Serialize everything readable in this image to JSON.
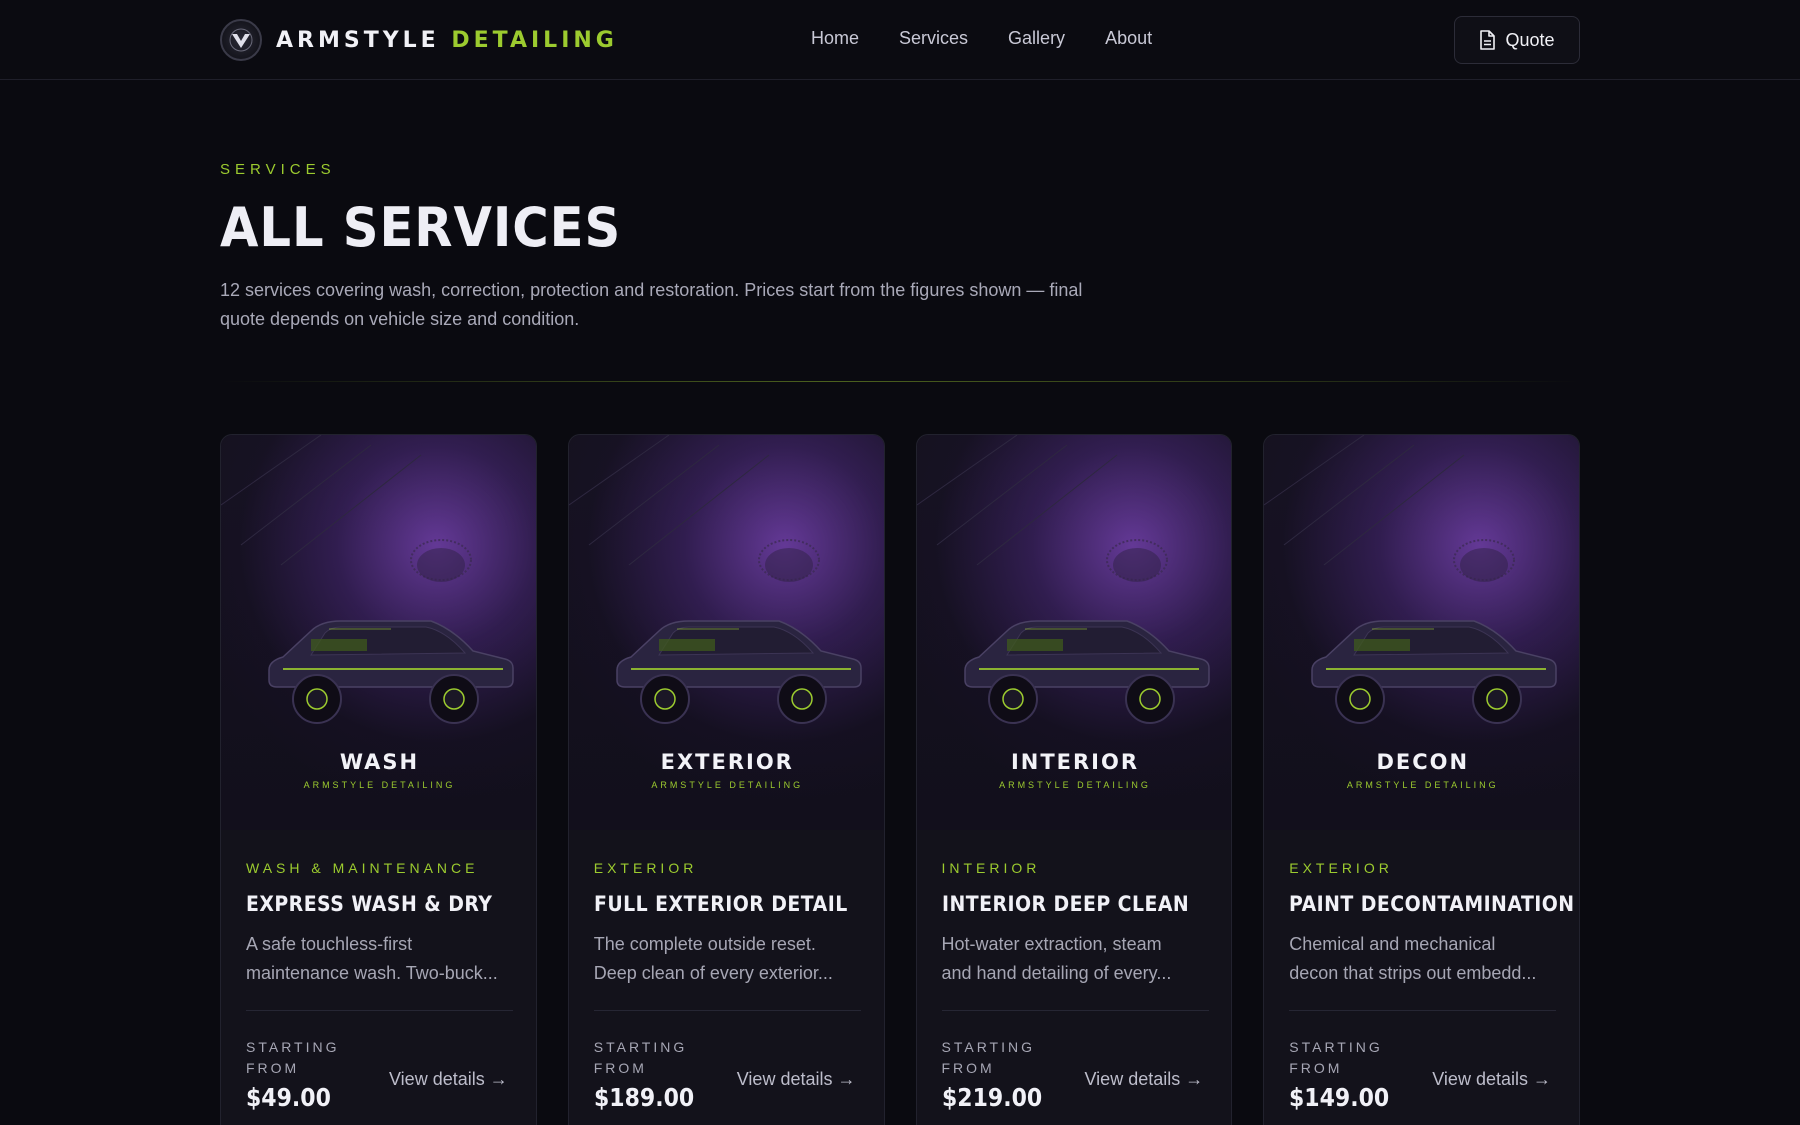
{
  "header": {
    "brand_primary": "ARMSTYLE",
    "brand_accent": "DETAILING",
    "nav": [
      "Home",
      "Services",
      "Gallery",
      "About"
    ],
    "quote_label": "Quote"
  },
  "hero": {
    "eyebrow": "SERVICES",
    "title": "ALL SERVICES",
    "lede": "12 services covering wash, correction, protection and restoration. Prices start from the figures shown — final quote depends on vehicle size and condition."
  },
  "colors": {
    "accent": "#9ccb2f",
    "glow": "#7e46be",
    "background": "#0a0a10"
  },
  "cards": [
    {
      "thumb_title": "WASH",
      "thumb_sub": "ARMSTYLE DETAILING",
      "category": "WASH & MAINTENANCE",
      "name": "EXPRESS WASH & DRY",
      "desc_line1": "A safe touchless-first",
      "desc_line2": "maintenance wash. Two-buck...",
      "price_label": "STARTING FROM",
      "price": "$49.00",
      "details": "View details →"
    },
    {
      "thumb_title": "EXTERIOR",
      "thumb_sub": "ARMSTYLE DETAILING",
      "category": "EXTERIOR",
      "name": "FULL EXTERIOR DETAIL",
      "desc_line1": "The complete outside reset.",
      "desc_line2": "Deep clean of every exterior...",
      "price_label": "STARTING FROM",
      "price": "$189.00",
      "details": "View details →"
    },
    {
      "thumb_title": "INTERIOR",
      "thumb_sub": "ARMSTYLE DETAILING",
      "category": "INTERIOR",
      "name": "INTERIOR DEEP CLEAN",
      "desc_line1": "Hot-water extraction, steam",
      "desc_line2": "and hand detailing of every...",
      "price_label": "STARTING FROM",
      "price": "$219.00",
      "details": "View details →"
    },
    {
      "thumb_title": "DECON",
      "thumb_sub": "ARMSTYLE DETAILING",
      "category": "EXTERIOR",
      "name": "PAINT DECONTAMINATION",
      "desc_line1": "Chemical and mechanical",
      "desc_line2": "decon that strips out embedd...",
      "price_label": "STARTING FROM",
      "price": "$149.00",
      "details": "View details →"
    }
  ]
}
